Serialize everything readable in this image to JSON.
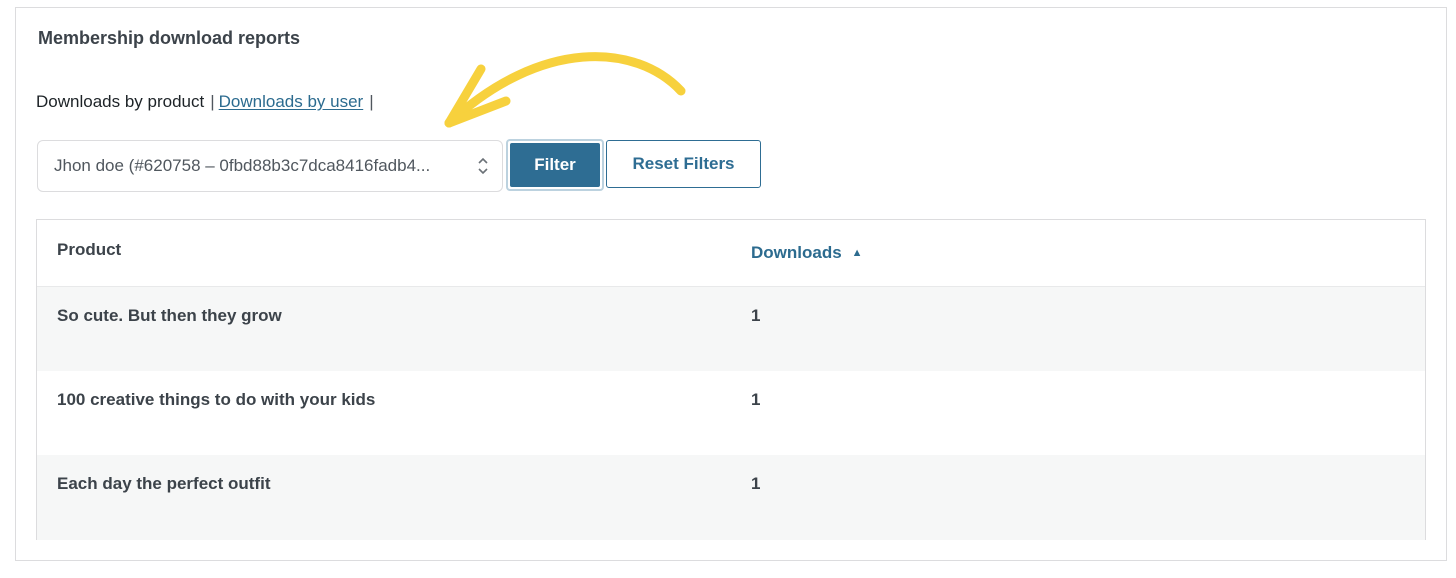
{
  "panel": {
    "title": "Membership download reports"
  },
  "views": {
    "current": "Downloads by product",
    "separator": "|",
    "other_link": "Downloads by user"
  },
  "filter": {
    "selected_user": "Jhon doe (#620758 – 0fbd88b3c7dca8416fadb4...",
    "filter_label": "Filter",
    "reset_label": "Reset Filters"
  },
  "table": {
    "columns": {
      "product": "Product",
      "downloads": "Downloads",
      "sort_indicator": "▲"
    },
    "rows": [
      {
        "product": "So cute. But then they grow",
        "downloads": "1"
      },
      {
        "product": "100 creative things to do with your kids",
        "downloads": "1"
      },
      {
        "product": "Each day the perfect outfit",
        "downloads": "1"
      }
    ]
  },
  "colors": {
    "accent": "#2e6d93",
    "annotation_arrow": "#f7d13d",
    "border": "#dcdcde"
  },
  "icons": {
    "select_chevron": "chevron-up-down-icon",
    "annotation": "curved-arrow-icon"
  }
}
